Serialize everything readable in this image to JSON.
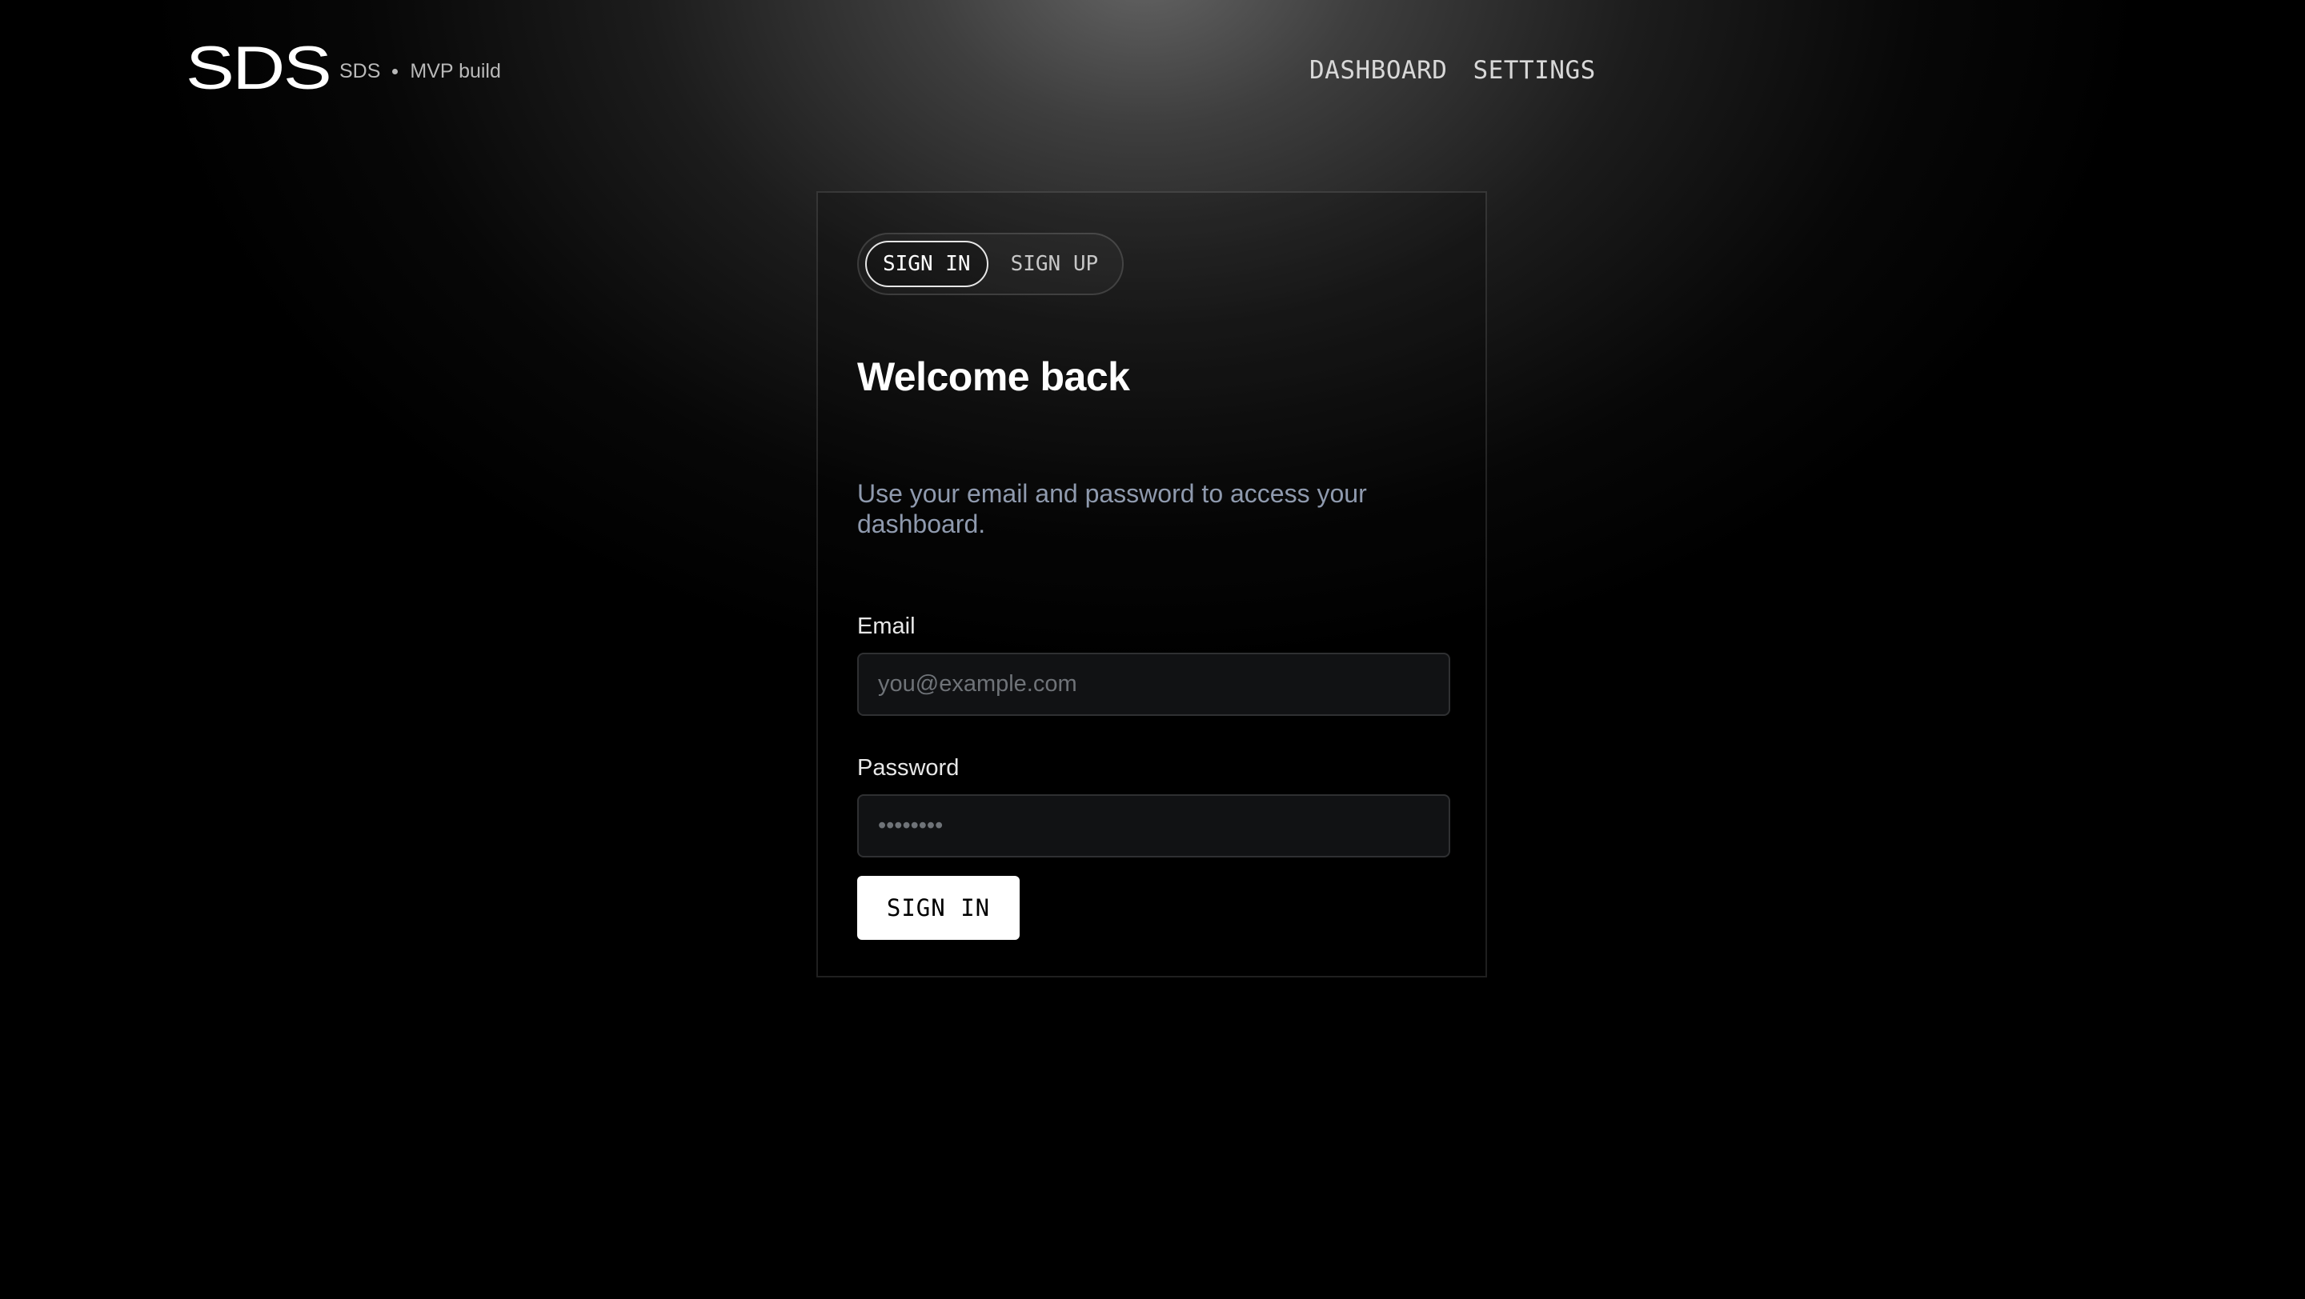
{
  "header": {
    "logo_text": "SDS",
    "brand": "SDS",
    "build": "MVP build",
    "nav": [
      {
        "label": "DASHBOARD"
      },
      {
        "label": "SETTINGS"
      }
    ]
  },
  "auth": {
    "tabs": [
      {
        "label": "SIGN IN",
        "active": true
      },
      {
        "label": "SIGN UP",
        "active": false
      }
    ],
    "title": "Welcome back",
    "subtitle": "Use your email and password to access your dashboard.",
    "email": {
      "label": "Email",
      "placeholder": "you@example.com",
      "value": ""
    },
    "password": {
      "label": "Password",
      "placeholder": "••••••••",
      "value": ""
    },
    "submit_label": "SIGN IN"
  }
}
